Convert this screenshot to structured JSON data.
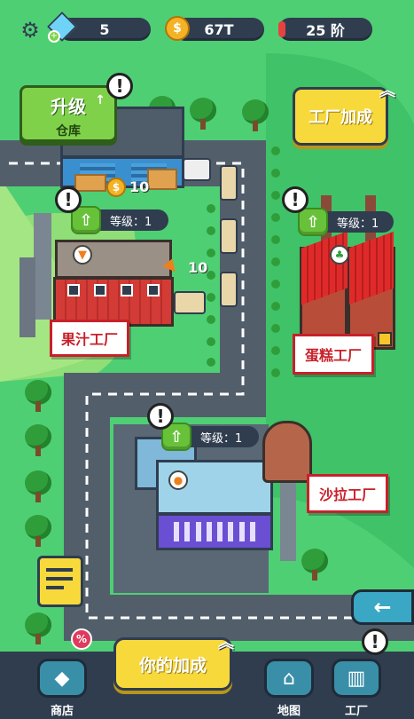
{
  "hud": {
    "settings_icon": "gear-icon",
    "gems": "5",
    "coins": "67T",
    "stage": "25 阶"
  },
  "warehouse": {
    "upgrade_label": "升级",
    "name": "仓库",
    "coin_reward": "10"
  },
  "juice_factory": {
    "level": "等级：1",
    "sign": "果汁工厂",
    "carrot_count": "10"
  },
  "cake_factory": {
    "level": "等级：1",
    "sign": "蛋糕工厂"
  },
  "salad_factory": {
    "level": "等级：1",
    "sign": "沙拉工厂"
  },
  "factory_boost": {
    "label": "工厂加成"
  },
  "your_boost": {
    "label": "你的加成"
  },
  "nav": {
    "shop": "商店",
    "shop_badge": "%",
    "map": "地图",
    "factory": "工厂"
  },
  "colors": {
    "grass": "#4fcf74",
    "road": "#525f6b",
    "hud_dark": "#2f3d4f",
    "yellow_button": "#f7d93c",
    "green_button": "#7fd14a",
    "sign_red": "#c8202a"
  }
}
